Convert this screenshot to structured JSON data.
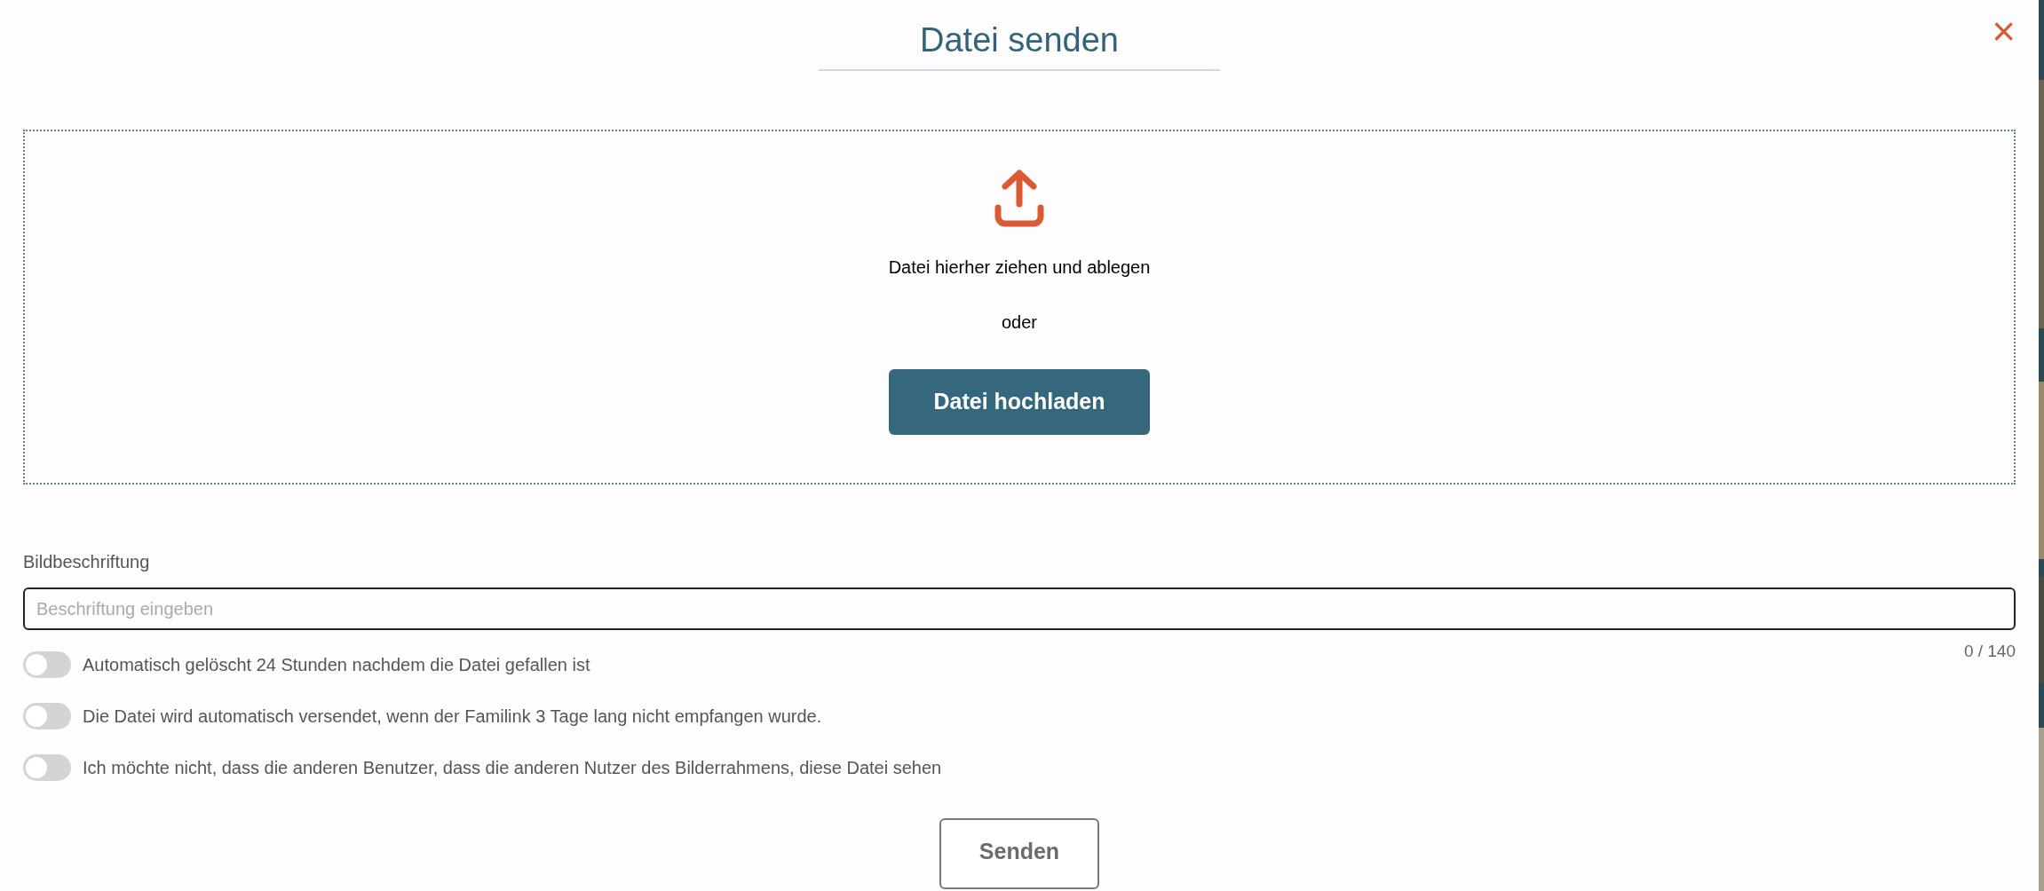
{
  "dialog": {
    "title": "Datei senden",
    "close": "×"
  },
  "dropzone": {
    "hint": "Datei hierher ziehen und ablegen",
    "separator": "oder",
    "button": "Datei hochladen"
  },
  "caption": {
    "label": "Bildbeschriftung",
    "placeholder": "Beschriftung eingeben",
    "counter": "0 / 140"
  },
  "options": [
    {
      "label": "Automatisch gelöscht 24 Stunden nachdem die Datei gefallen ist",
      "on": false
    },
    {
      "label": "Die Datei wird automatisch versendet, wenn der Familink 3 Tage lang nicht empfangen wurde.",
      "on": false
    },
    {
      "label": "Ich möchte nicht, dass die anderen Benutzer, dass die anderen Nutzer des Bilderrahmens, diese Datei sehen",
      "on": false
    }
  ],
  "submit": "Senden"
}
